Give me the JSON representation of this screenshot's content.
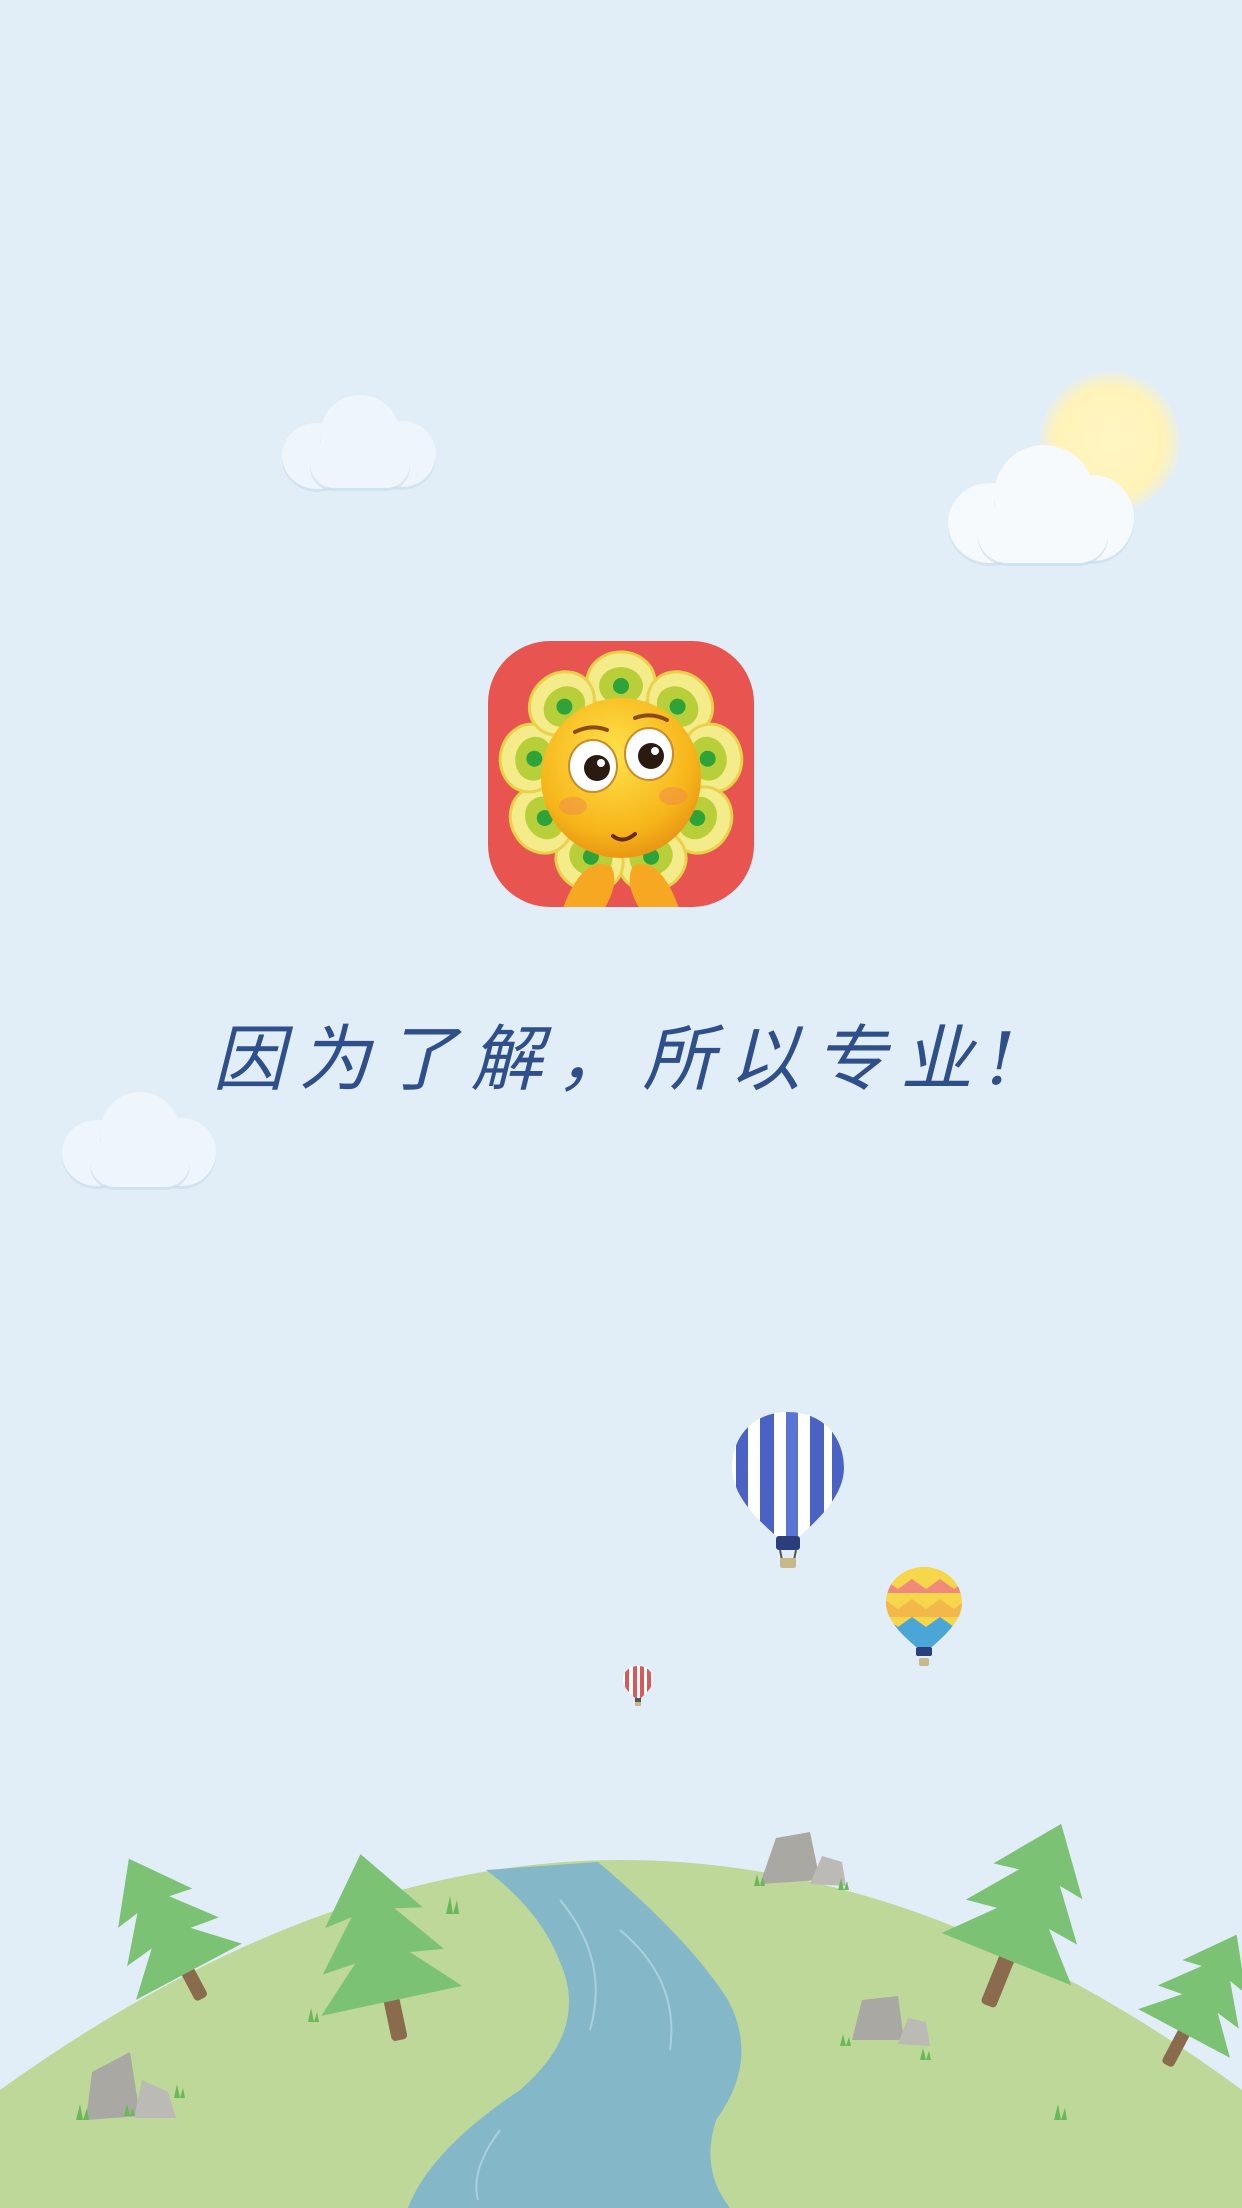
{
  "splash": {
    "slogan": "因为了解，所以专业!"
  },
  "colors": {
    "sky": "#e2eef7",
    "sun": "#fff3b8",
    "cloud": "#eef5fb",
    "icon_bg": "#e85550",
    "slogan": "#2e4f8a",
    "hill": "#bdd898",
    "river": "#84b8c9",
    "tree": "#7cc274",
    "trunk": "#8a6b4e",
    "rock": "#aaa8a3"
  },
  "icons": {
    "app_logo": "sunflower-emoji-logo-icon",
    "balloon": "hot-air-balloon-icon"
  }
}
